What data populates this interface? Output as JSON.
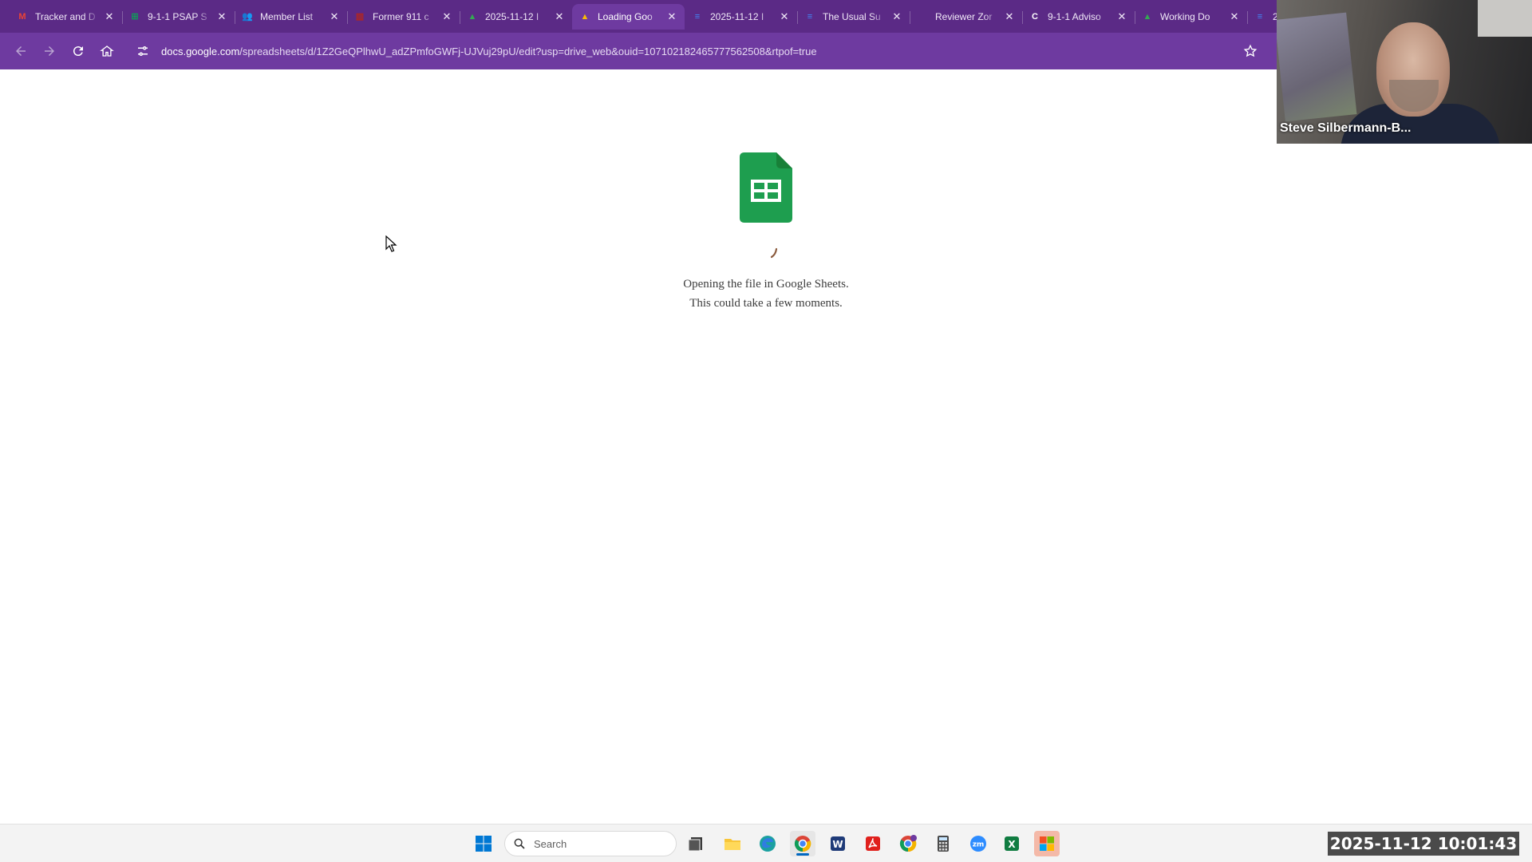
{
  "browser": {
    "tabs": [
      {
        "title": "Tracker and D",
        "icon": "gmail-icon",
        "favtext": "M",
        "color": "#ea4335",
        "active": false
      },
      {
        "title": "9-1-1 PSAP S",
        "icon": "sheets-icon",
        "favtext": "⊞",
        "color": "#0f9d58",
        "active": false
      },
      {
        "title": "Member List",
        "icon": "people-icon",
        "favtext": "👥",
        "color": "#5c8dd6",
        "active": false
      },
      {
        "title": "Former 911 c",
        "icon": "report-icon",
        "favtext": "▥",
        "color": "#b3261e",
        "active": false
      },
      {
        "title": "2025-11-12 I",
        "icon": "drive-icon",
        "favtext": "▲",
        "color": "#34a853",
        "active": false
      },
      {
        "title": "Loading Goo",
        "icon": "drive-icon",
        "favtext": "▲",
        "color": "#fbbc04",
        "active": true
      },
      {
        "title": "2025-11-12 I",
        "icon": "docs-icon",
        "favtext": "≡",
        "color": "#4285f4",
        "active": false
      },
      {
        "title": "The Usual Su",
        "icon": "docs-icon",
        "favtext": "≡",
        "color": "#4285f4",
        "active": false
      },
      {
        "title": "Reviewer Zor",
        "icon": "blank-icon",
        "favtext": "",
        "color": "#3a2a50",
        "active": false
      },
      {
        "title": "9-1-1 Adviso",
        "icon": "site-icon",
        "favtext": "C",
        "color": "#ffffff",
        "active": false
      },
      {
        "title": "Working Do",
        "icon": "drive-icon",
        "favtext": "▲",
        "color": "#34a853",
        "active": false
      },
      {
        "title": "2",
        "icon": "docs-icon",
        "favtext": "≡",
        "color": "#4285f4",
        "active": false
      }
    ],
    "url_host": "docs.google.com",
    "url_path": "/spreadsheets/d/1Z2GeQPlhwU_adZPmfoGWFj-UJVuj29pU/edit?usp=drive_web&ouid=107102182465777562508&rtpof=true",
    "accent_color": "#6e3aa0"
  },
  "page": {
    "loading_line1": "Opening the file in Google Sheets.",
    "loading_line2": "This could take a few moments.",
    "logo_icon": "google-sheets-icon",
    "logo_color": "#1e9e4f"
  },
  "video": {
    "participant_name": "Steve Silbermann-B..."
  },
  "taskbar": {
    "search_placeholder": "Search",
    "apps": [
      "windows-start-icon",
      "task-view-icon",
      "file-explorer-icon",
      "edge-icon",
      "chrome-icon",
      "word-icon",
      "acrobat-icon",
      "chrome-profile-icon",
      "calculator-icon",
      "zoom-icon",
      "excel-icon",
      "microsoft-store-icon"
    ]
  },
  "overlay": {
    "timestamp": "2025-11-12 10:01:43"
  }
}
